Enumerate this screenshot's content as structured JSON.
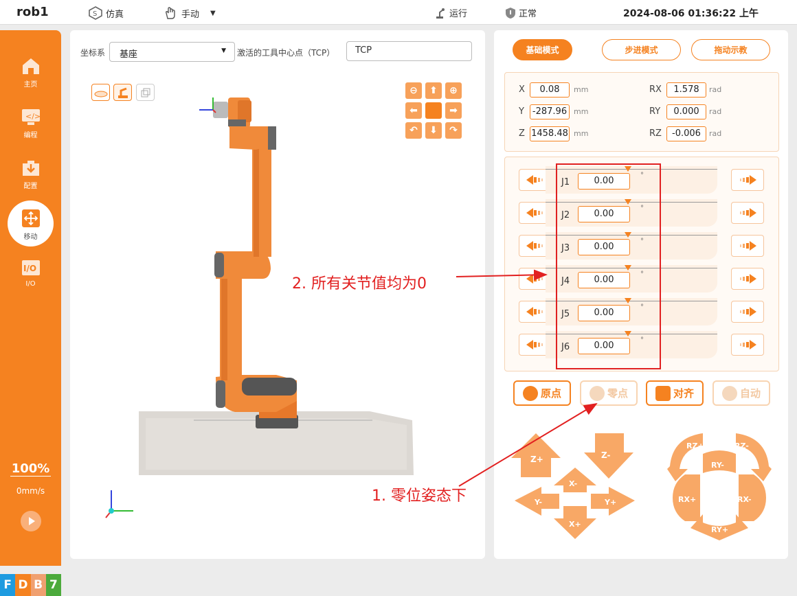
{
  "header": {
    "app_name": "rob1",
    "simulation_label": "仿真",
    "manual_label": "手动",
    "run_label": "运行",
    "status_label": "正常",
    "datetime": "2024-08-06 01:36:22 上午"
  },
  "sidebar": {
    "items": [
      {
        "label": "主页",
        "icon": "home-icon"
      },
      {
        "label": "编程",
        "icon": "code-icon"
      },
      {
        "label": "配置",
        "icon": "download-icon"
      },
      {
        "label": "移动",
        "icon": "move-icon"
      },
      {
        "label": "I/O",
        "icon": "io-icon"
      }
    ],
    "active_index": 3,
    "speed_percent": "100%",
    "speed_mms": "0mm/s",
    "badges": [
      {
        "letter": "F",
        "color": "#1e9be0"
      },
      {
        "letter": "D",
        "color": "#f58220"
      },
      {
        "letter": "B",
        "color": "#f0a070"
      },
      {
        "letter": "7",
        "color": "#4caa3c"
      }
    ]
  },
  "viewport": {
    "coord_label": "坐标系",
    "coord_value": "基座",
    "tcp_label": "激活的工具中心点（TCP）",
    "tcp_value": "TCP"
  },
  "modes": {
    "basic": "基础模式",
    "step": "步进模式",
    "drag": "拖动示教"
  },
  "cartesian": [
    {
      "axis": "X",
      "value": "0.08",
      "unit": "mm"
    },
    {
      "axis": "Y",
      "value": "-287.96",
      "unit": "mm"
    },
    {
      "axis": "Z",
      "value": "1458.48",
      "unit": "mm"
    },
    {
      "axis": "RX",
      "value": "1.578",
      "unit": "rad"
    },
    {
      "axis": "RY",
      "value": "0.000",
      "unit": "rad"
    },
    {
      "axis": "RZ",
      "value": "-0.006",
      "unit": "rad"
    }
  ],
  "joints": [
    {
      "name": "J1",
      "value": "0.00",
      "unit": "°"
    },
    {
      "name": "J2",
      "value": "0.00",
      "unit": "°"
    },
    {
      "name": "J3",
      "value": "0.00",
      "unit": "°"
    },
    {
      "name": "J4",
      "value": "0.00",
      "unit": "°"
    },
    {
      "name": "J5",
      "value": "0.00",
      "unit": "°"
    },
    {
      "name": "J6",
      "value": "0.00",
      "unit": "°"
    }
  ],
  "functions": {
    "home": "原点",
    "zero": "零点",
    "align": "对齐",
    "auto": "自动"
  },
  "jog_linear": {
    "zplus": "Z+",
    "zminus": "Z-",
    "xminus": "X-",
    "xplus": "X+",
    "yminus": "Y-",
    "yplus": "Y+"
  },
  "jog_rot": {
    "rzplus": "RZ+",
    "rzminus": "RZ-",
    "ryminus": "RY-",
    "ryplus": "RY+",
    "rxplus": "RX+",
    "rxminus": "RX-"
  },
  "annotations": {
    "note2": "2. 所有关节值均为0",
    "note1": "1. 零位姿态下"
  },
  "colors": {
    "accent": "#f58220",
    "annotation": "#e22020"
  }
}
